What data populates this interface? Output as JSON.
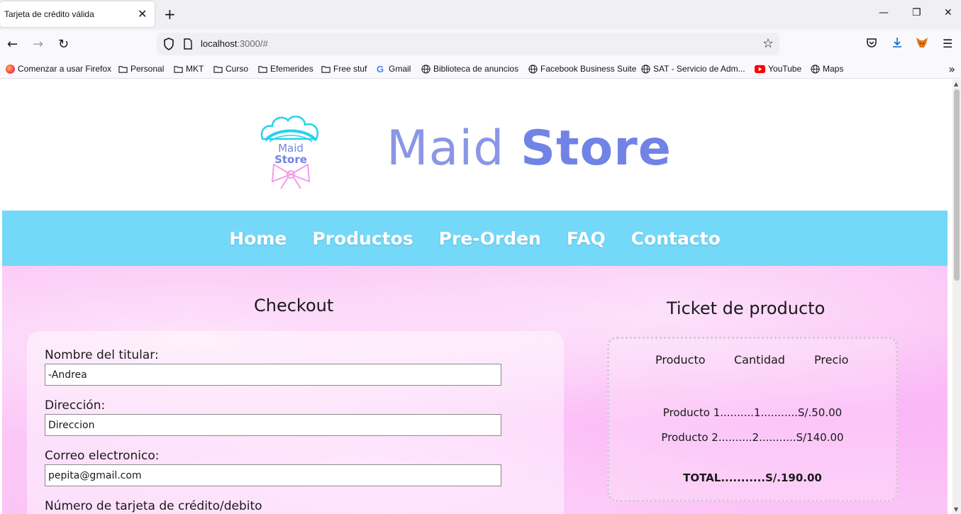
{
  "browser": {
    "tab_title": "Tarjeta de crédito válida",
    "tab_close": "✕",
    "new_tab": "+",
    "window_controls": [
      "—",
      "❐",
      "✕"
    ],
    "url_host": "localhost",
    "url_rest": ":3000/#",
    "bookmarks": [
      {
        "label": "Comenzar a usar Firefox",
        "icon": "firefox-icon"
      },
      {
        "label": "Personal",
        "icon": "folder-icon"
      },
      {
        "label": "MKT",
        "icon": "folder-icon"
      },
      {
        "label": "Curso",
        "icon": "folder-icon"
      },
      {
        "label": "Efemerides",
        "icon": "folder-icon"
      },
      {
        "label": "Free stuf",
        "icon": "folder-icon"
      },
      {
        "label": "Gmail",
        "icon": "google-icon"
      },
      {
        "label": "Biblioteca de anuncios",
        "icon": "globe-icon"
      },
      {
        "label": "Facebook Business Suite",
        "icon": "globe-icon"
      },
      {
        "label": "SAT - Servicio de Adm...",
        "icon": "globe-icon"
      },
      {
        "label": "YouTube",
        "icon": "youtube-icon"
      },
      {
        "label": "Maps",
        "icon": "globe-icon"
      }
    ],
    "bookmarks_more": "»"
  },
  "site": {
    "wordmark_light": "Maid",
    "wordmark_bold": "Store",
    "logo_text_top": "Maid",
    "logo_text_bottom": "Store",
    "nav": [
      "Home",
      "Productos",
      "Pre-Orden",
      "FAQ",
      "Contacto"
    ]
  },
  "checkout": {
    "title": "Checkout",
    "fields": [
      {
        "label": "Nombre del titular:",
        "value": "-Andrea"
      },
      {
        "label": "Dirección:",
        "value": "Direccion"
      },
      {
        "label": "Correo electronico:",
        "value": "pepita@gmail.com"
      },
      {
        "label": "Número de tarjeta de crédito/debito",
        "value": ""
      }
    ]
  },
  "ticket": {
    "title": "Ticket de producto",
    "headers": [
      "Producto",
      "Cantidad",
      "Precio"
    ],
    "lines": [
      "Producto 1..........1...........S/.50.00",
      "Producto 2..........2...........S/140.00"
    ],
    "total": "TOTAL...........S/.190.00"
  },
  "colors": {
    "nav_bg": "#74d9f8",
    "wordmark": "#7183e6",
    "content_bg": "#fbc4f6"
  }
}
